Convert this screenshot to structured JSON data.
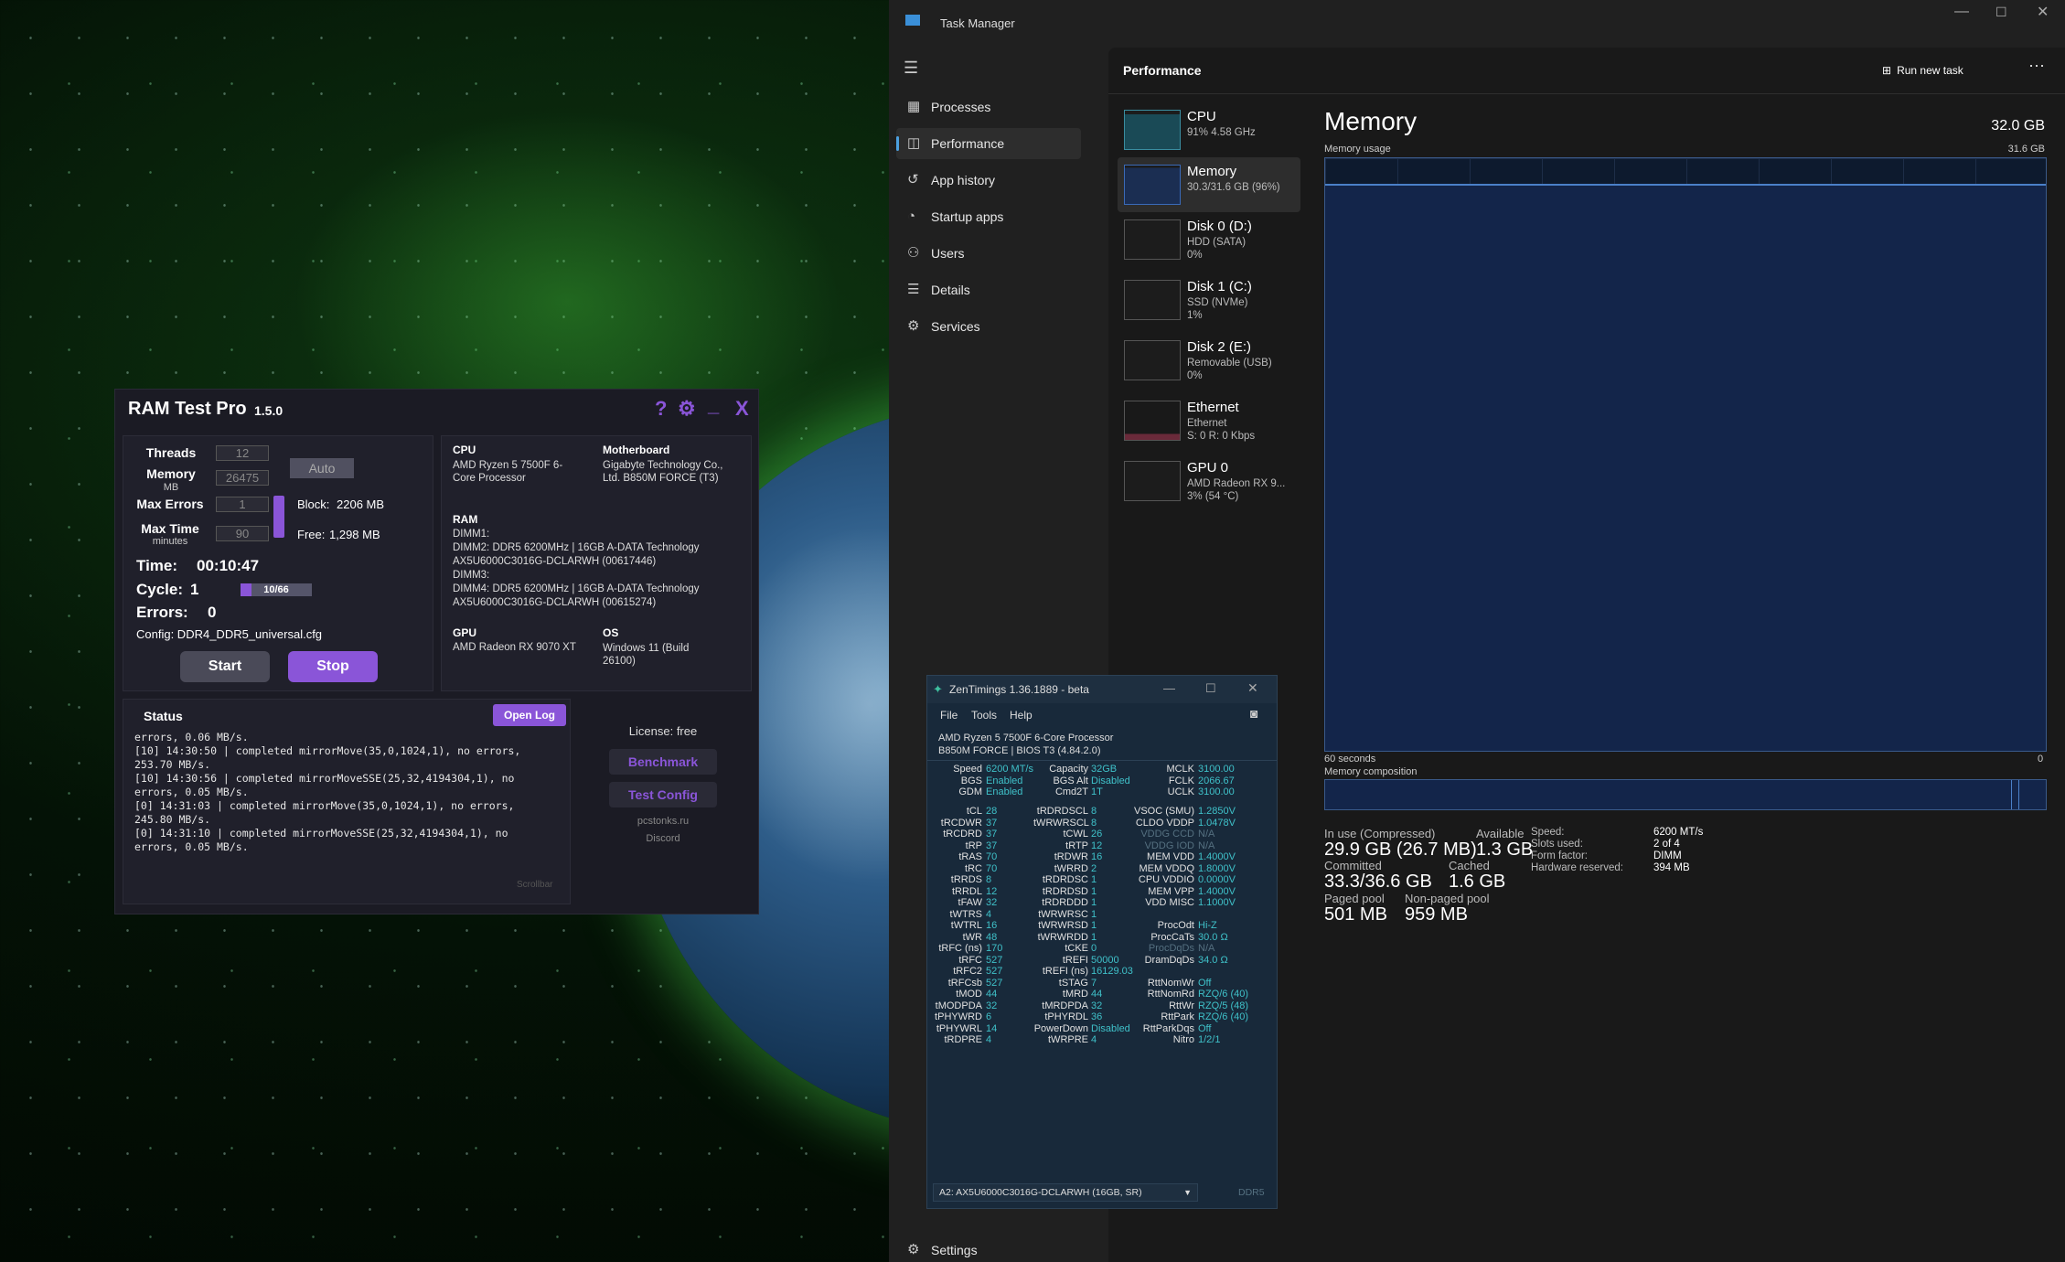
{
  "ramtest": {
    "title": "RAM Test Pro",
    "version": "1.5.0",
    "threads_label": "Threads",
    "threads_value": "12",
    "memory_label": "Memory",
    "memory_unit": "MB",
    "memory_value": "26475",
    "auto_label": "Auto",
    "maxerr_label": "Max Errors",
    "maxerr_value": "1",
    "maxtime_label": "Max Time",
    "maxtime_unit": "minutes",
    "maxtime_value": "90",
    "block_label": "Block:",
    "block_value": "2206 MB",
    "free_label": "Free:",
    "free_value": "1,298 MB",
    "time_label": "Time:",
    "time_value": "00:10:47",
    "cycle_label": "Cycle:",
    "cycle_value": "1",
    "cycle_progress": "10/66",
    "cycle_fraction": 0.15,
    "errors_label": "Errors:",
    "errors_value": "0",
    "config": "Config: DDR4_DDR5_universal.cfg",
    "start_label": "Start",
    "stop_label": "Stop",
    "cpu_h": "CPU",
    "cpu_v": "AMD Ryzen 5 7500F 6-Core Processor",
    "mb_h": "Motherboard",
    "mb_v": "Gigabyte Technology Co., Ltd. B850M FORCE (T3)",
    "ram_h": "RAM",
    "ram_lines": [
      "DIMM1:",
      "DIMM2: DDR5 6200MHz | 16GB A-DATA Technology",
      "AX5U6000C3016G-DCLARWH (00617446)",
      "DIMM3:",
      "DIMM4: DDR5 6200MHz | 16GB A-DATA Technology",
      "AX5U6000C3016G-DCLARWH (00615274)"
    ],
    "gpu_h": "GPU",
    "gpu_v": "AMD Radeon RX 9070 XT",
    "os_h": "OS",
    "os_v": "Windows 11 (Build 26100)",
    "status_h": "Status",
    "openlog_label": "Open Log",
    "log": "errors, 0.06 MB/s.\n[10] 14:30:50 | completed mirrorMove(35,0,1024,1), no errors,\n253.70 MB/s.\n[10] 14:30:56 | completed mirrorMoveSSE(25,32,4194304,1), no\nerrors, 0.05 MB/s.\n[0] 14:31:03 | completed mirrorMove(35,0,1024,1), no errors,\n245.80 MB/s.\n[0] 14:31:10 | completed mirrorMoveSSE(25,32,4194304,1), no\nerrors, 0.05 MB/s.",
    "scroll_label": "Scrollbar",
    "license": "License: free",
    "bench_label": "Benchmark",
    "testcfg_label": "Test Config",
    "site": "pcstonks.ru",
    "discord": "Discord"
  },
  "taskmgr": {
    "title": "Task Manager",
    "header": "Performance",
    "run_task": "Run new task",
    "nav": [
      {
        "label": "Processes",
        "icon": "grid-icon"
      },
      {
        "label": "Performance",
        "icon": "performance-icon"
      },
      {
        "label": "App history",
        "icon": "history-icon"
      },
      {
        "label": "Startup apps",
        "icon": "startup-icon"
      },
      {
        "label": "Users",
        "icon": "users-icon"
      },
      {
        "label": "Details",
        "icon": "list-icon"
      },
      {
        "label": "Services",
        "icon": "services-icon"
      }
    ],
    "settings": "Settings",
    "resources": [
      {
        "name": "CPU",
        "l1": "91% 4.58 GHz",
        "l2": ""
      },
      {
        "name": "Memory",
        "l1": "30.3/31.6 GB (96%)",
        "l2": ""
      },
      {
        "name": "Disk 0 (D:)",
        "l1": "HDD (SATA)",
        "l2": "0%"
      },
      {
        "name": "Disk 1 (C:)",
        "l1": "SSD (NVMe)",
        "l2": "1%"
      },
      {
        "name": "Disk 2 (E:)",
        "l1": "Removable (USB)",
        "l2": "0%"
      },
      {
        "name": "Ethernet",
        "l1": "Ethernet",
        "l2": "S: 0 R: 0 Kbps"
      },
      {
        "name": "GPU 0",
        "l1": "AMD Radeon RX 9...",
        "l2": "3% (54 °C)"
      }
    ],
    "mem_title": "Memory",
    "mem_total": "32.0 GB",
    "usage_label": "Memory usage",
    "usage_max": "31.6 GB",
    "seconds": "60 seconds",
    "zero": "0",
    "comp_label": "Memory composition",
    "inuse_l": "In use (Compressed)",
    "inuse_v": "29.9 GB (26.7 MB)",
    "avail_l": "Available",
    "avail_v": "1.3 GB",
    "committed_l": "Committed",
    "committed_v": "33.3/36.6 GB",
    "cached_l": "Cached",
    "cached_v": "1.6 GB",
    "paged_l": "Paged pool",
    "paged_v": "501 MB",
    "nonpaged_l": "Non-paged pool",
    "nonpaged_v": "959 MB",
    "speed_l": "Speed:",
    "speed_v": "6200 MT/s",
    "slots_l": "Slots used:",
    "slots_v": "2 of 4",
    "form_l": "Form factor:",
    "form_v": "DIMM",
    "hwres_l": "Hardware reserved:",
    "hwres_v": "394 MB"
  },
  "zen": {
    "title": "ZenTimings 1.36.1889 - beta",
    "menu": [
      "File",
      "Tools",
      "Help"
    ],
    "cpu": "AMD Ryzen 5 7500F 6-Core Processor",
    "board": "B850M FORCE | BIOS T3 (4.84.2.0)",
    "top": [
      [
        "Speed",
        "6200 MT/s",
        "Capacity",
        "32GB",
        "MCLK",
        "3100.00"
      ],
      [
        "BGS",
        "Enabled",
        "BGS Alt",
        "Disabled",
        "FCLK",
        "2066.67"
      ],
      [
        "GDM",
        "Enabled",
        "Cmd2T",
        "1T",
        "UCLK",
        "3100.00"
      ]
    ],
    "rows": [
      [
        "tCL",
        "28",
        "tRDRDSCL",
        "8",
        "VSOC (SMU)",
        "1.2850V"
      ],
      [
        "tRCDWR",
        "37",
        "tWRWRSCL",
        "8",
        "CLDO VDDP",
        "1.0478V"
      ],
      [
        "tRCDRD",
        "37",
        "tCWL",
        "26",
        "VDDG CCD",
        "N/A"
      ],
      [
        "tRP",
        "37",
        "tRTP",
        "12",
        "VDDG IOD",
        "N/A"
      ],
      [
        "tRAS",
        "70",
        "tRDWR",
        "16",
        "MEM VDD",
        "1.4000V"
      ],
      [
        "tRC",
        "70",
        "tWRRD",
        "2",
        "MEM VDDQ",
        "1.8000V"
      ],
      [
        "tRRDS",
        "8",
        "tRDRDSC",
        "1",
        "CPU VDDIO",
        "0.0000V"
      ],
      [
        "tRRDL",
        "12",
        "tRDRDSD",
        "1",
        "MEM VPP",
        "1.4000V"
      ],
      [
        "tFAW",
        "32",
        "tRDRDDD",
        "1",
        "VDD MISC",
        "1.1000V"
      ],
      [
        "tWTRS",
        "4",
        "tWRWRSC",
        "1",
        "",
        ""
      ],
      [
        "tWTRL",
        "16",
        "tWRWRSD",
        "1",
        "ProcOdt",
        "Hi-Z"
      ],
      [
        "tWR",
        "48",
        "tWRWRDD",
        "1",
        "ProcCaTs",
        "30.0 Ω"
      ],
      [
        "tRFC (ns)",
        "170",
        "tCKE",
        "0",
        "ProcDqDs",
        "N/A"
      ],
      [
        "tRFC",
        "527",
        "tREFI",
        "50000",
        "DramDqDs",
        "34.0 Ω"
      ],
      [
        "tRFC2",
        "527",
        "tREFI (ns)",
        "16129.03",
        "",
        ""
      ],
      [
        "tRFCsb",
        "527",
        "tSTAG",
        "7",
        "RttNomWr",
        "Off"
      ],
      [
        "tMOD",
        "44",
        "tMRD",
        "44",
        "RttNomRd",
        "RZQ/6 (40)"
      ],
      [
        "tMODPDA",
        "32",
        "tMRDPDA",
        "32",
        "RttWr",
        "RZQ/5 (48)"
      ],
      [
        "tPHYWRD",
        "6",
        "tPHYRDL",
        "36",
        "RttPark",
        "RZQ/6 (40)"
      ],
      [
        "tPHYWRL",
        "14",
        "PowerDown",
        "Disabled",
        "RttParkDqs",
        "Off"
      ],
      [
        "tRDPRE",
        "4",
        "tWRPRE",
        "4",
        "Nitro",
        "1/2/1"
      ]
    ],
    "dimm": "A2: AX5U6000C3016G-DCLARWH (16GB, SR)",
    "ddr": "DDR5"
  },
  "colors": {
    "accent": "#8a55d8",
    "teal": "#3fc1c9",
    "tm_blue": "#4ca0e0"
  }
}
